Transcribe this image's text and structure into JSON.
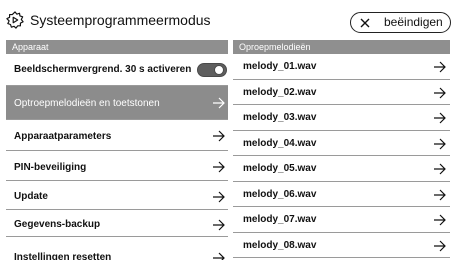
{
  "header": {
    "title": "Systeemprogrammeermodus",
    "end_button_label": "beëindigen",
    "settings_icon": "gear-icon",
    "close_icon": "close-icon"
  },
  "left_panel": {
    "header": "Apparaat",
    "items": [
      {
        "label": "Beeldschermvergrend. 30 s activeren",
        "control": "toggle",
        "toggle_on": true
      },
      {
        "label": "Optroepmelodieën en toetstonen",
        "selected": true
      },
      {
        "label": "Apparaatparameters"
      },
      {
        "label": "PIN-beveiliging"
      },
      {
        "label": "Update"
      },
      {
        "label": "Gegevens-backup"
      },
      {
        "label": "Instellingen resetten"
      }
    ]
  },
  "right_panel": {
    "header": "Oproepmelodieën",
    "items": [
      {
        "label": "melody_01.wav"
      },
      {
        "label": "melody_02.wav"
      },
      {
        "label": "melody_03.wav"
      },
      {
        "label": "melody_04.wav"
      },
      {
        "label": "melody_05.wav"
      },
      {
        "label": "melody_06.wav"
      },
      {
        "label": "melody_07.wav"
      },
      {
        "label": "melody_08.wav"
      }
    ]
  },
  "colors": {
    "panel_header_bg": "#8f8f8f",
    "selected_row_bg": "#8c8c8c",
    "toggle_bg": "#5f5f5f"
  }
}
